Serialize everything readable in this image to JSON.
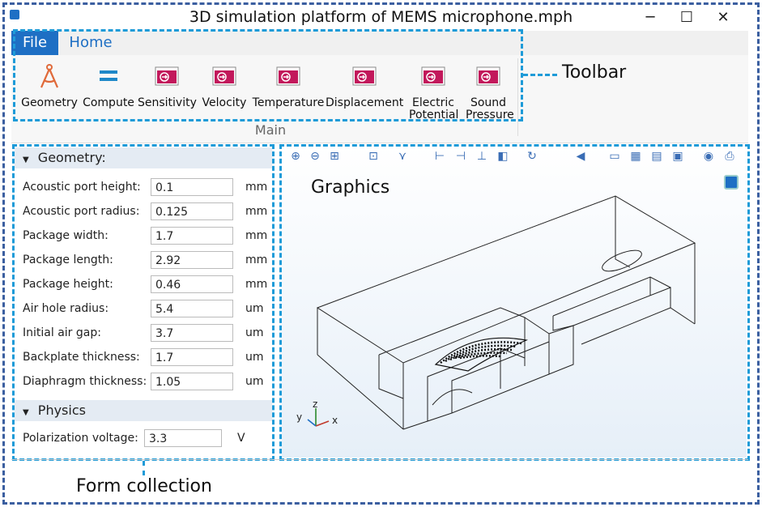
{
  "window": {
    "title": "3D simulation platform of MEMS microphone.mph",
    "minimize_glyph": "─",
    "maximize_glyph": "☐",
    "close_glyph": "✕"
  },
  "menu": {
    "file_label": "File",
    "home_label": "Home"
  },
  "toolbar": {
    "group_label": "Main",
    "buttons": [
      {
        "label": "Geometry",
        "icon": "geometry-compass-icon"
      },
      {
        "label": "Compute",
        "icon": "equals-compute-icon"
      },
      {
        "label": "Sensitivity",
        "icon": "method-call-icon"
      },
      {
        "label": "Velocity",
        "icon": "method-call-icon"
      },
      {
        "label": "Temperature",
        "icon": "method-call-icon"
      },
      {
        "label": "Displacement",
        "icon": "method-call-icon"
      },
      {
        "label": "Electric Potential",
        "icon": "method-call-icon"
      },
      {
        "label": "Sound Pressure",
        "icon": "method-call-icon"
      }
    ]
  },
  "annotations": {
    "toolbar": "Toolbar",
    "graphics": "Graphics",
    "form": "Form collection"
  },
  "form": {
    "geometry_header": "Geometry:",
    "physics_header": "Physics",
    "geometry_rows": [
      {
        "label": "Acoustic port height:",
        "value": "0.1",
        "unit": "mm"
      },
      {
        "label": "Acoustic port radius:",
        "value": "0.125",
        "unit": "mm"
      },
      {
        "label": "Package width:",
        "value": "1.7",
        "unit": "mm"
      },
      {
        "label": "Package length:",
        "value": "2.92",
        "unit": "mm"
      },
      {
        "label": "Package height:",
        "value": "0.46",
        "unit": "mm"
      },
      {
        "label": "Air hole radius:",
        "value": "5.4",
        "unit": "um"
      },
      {
        "label": "Initial air gap:",
        "value": "3.7",
        "unit": "um"
      },
      {
        "label": "Backplate thickness:",
        "value": "1.7",
        "unit": "um"
      },
      {
        "label": "Diaphragm thickness:",
        "value": "1.05",
        "unit": "um"
      }
    ],
    "physics_rows": [
      {
        "label": "Polarization voltage:",
        "value": "3.3",
        "unit": "V"
      }
    ]
  },
  "graphics": {
    "axis_x": "x",
    "axis_y": "y",
    "axis_z": "z",
    "toolbar_icons": [
      "zoom-in-icon",
      "zoom-out-icon",
      "zoom-box-icon",
      "zoom-extents-icon",
      "view-axis-icon",
      "view-xy-icon",
      "view-yz-icon",
      "view-xz-icon",
      "toggle-view-icon",
      "rotate-icon",
      "select-icon",
      "transparency-icon",
      "wireframe-icon",
      "grid-icon",
      "scene-light-icon",
      "camera-icon",
      "print-icon"
    ]
  },
  "colors": {
    "accent_blue": "#1e6fc4",
    "annotation_dash": "#1e9bd8",
    "outer_dash": "#3b5fa0",
    "method_icon": "#c2185b"
  }
}
